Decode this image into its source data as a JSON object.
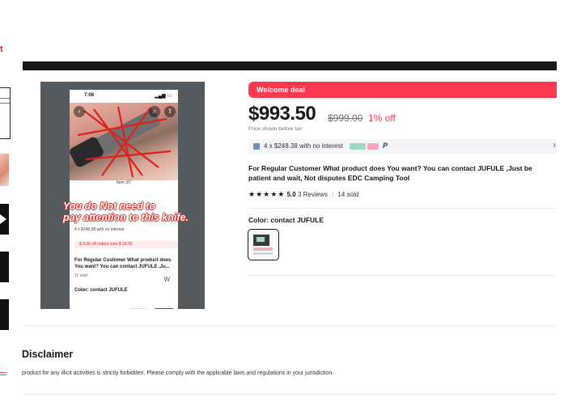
{
  "edge": {
    "text": "t"
  },
  "image": {
    "phone_time": "7:08",
    "phone_signal": "▂▄▆ ▭",
    "item_count": "Item 3/7",
    "overlay_line1": "You do Not need to",
    "overlay_line2": "pay attention to this knife.",
    "row_installments": "4 x $248.38 with no interest",
    "row_coupon": "$ 3.00 off orders over $ 29.00",
    "title": "For Regular Customer What product does You want? You can contact JUFULE ,Ju...",
    "sold": "11 sold",
    "color": "Color: contact JUFULE",
    "watermark": "W"
  },
  "deal": {
    "label": "Welcome deal"
  },
  "pricing": {
    "price": "$993.50",
    "original_price": "$999.00",
    "discount": "1% off",
    "tax_note": "Price shown before tax"
  },
  "installments": {
    "text": "4 x $248.38 with no interest",
    "paypal": "P",
    "chevron": "›"
  },
  "product": {
    "title": "For Regular Customer What product does You want? You can contact JUFULE ,Just be patient and wait, Not disputes EDC Camping Tool",
    "stars": "★★★★★",
    "rating": "5.0",
    "reviews": "3 Reviews",
    "separator": "|",
    "sold": "14 sold",
    "color_label": "Color: contact JUFULE"
  },
  "disclaimer": {
    "title": "Disclaimer",
    "text": "product for any illicit activities is strictly forbidden. Please comply with the applicable laws and regulations in your jurisdiction."
  },
  "colors": {
    "accent": "#fd384f",
    "overlay_red": "#e0201b",
    "dark_bar": "#191919"
  }
}
